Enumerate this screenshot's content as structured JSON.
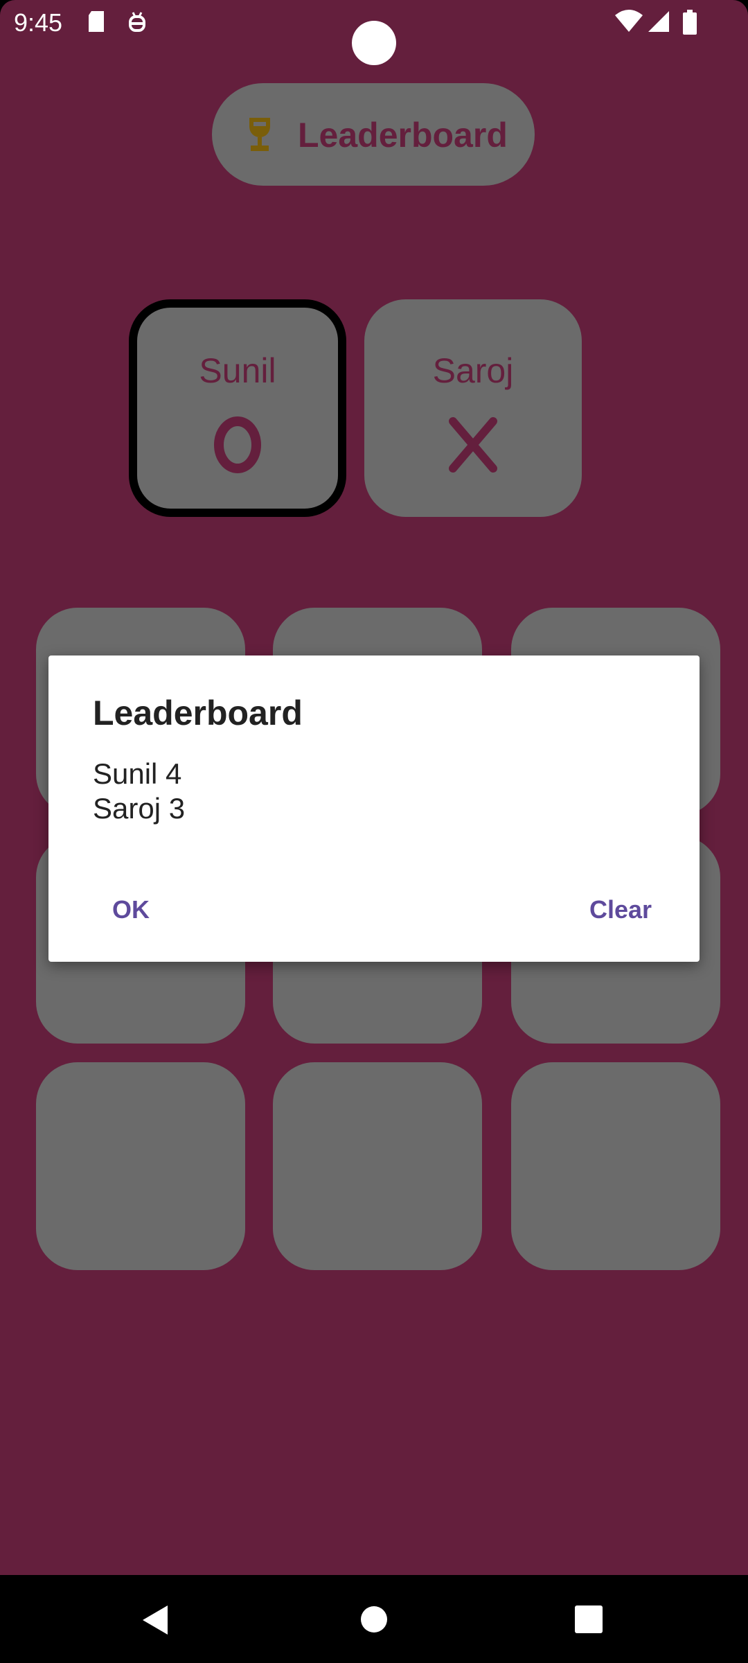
{
  "status_bar": {
    "time": "9:45",
    "icons": [
      "sd-card-icon",
      "debug-icon",
      "wifi-icon",
      "signal-icon",
      "battery-icon"
    ]
  },
  "header": {
    "leaderboard_button_label": "Leaderboard",
    "icon": "trophy-icon"
  },
  "players": [
    {
      "name": "Sunil",
      "symbol": "O",
      "active": true
    },
    {
      "name": "Saroj",
      "symbol": "X",
      "active": false
    }
  ],
  "board": {
    "cells": [
      "",
      "",
      "",
      "",
      "",
      "",
      "",
      "",
      ""
    ]
  },
  "dialog": {
    "title": "Leaderboard",
    "lines": [
      "Sunil 4",
      "Saroj 3"
    ],
    "ok_label": "OK",
    "clear_label": "Clear"
  },
  "navigation": {
    "icons": [
      "back-icon",
      "home-icon",
      "recents-icon"
    ]
  },
  "colors": {
    "background": "#641F3D",
    "card": "#6B6B6B",
    "dialog_button": "#5E4A9C",
    "trophy": "#7A5E0A"
  }
}
